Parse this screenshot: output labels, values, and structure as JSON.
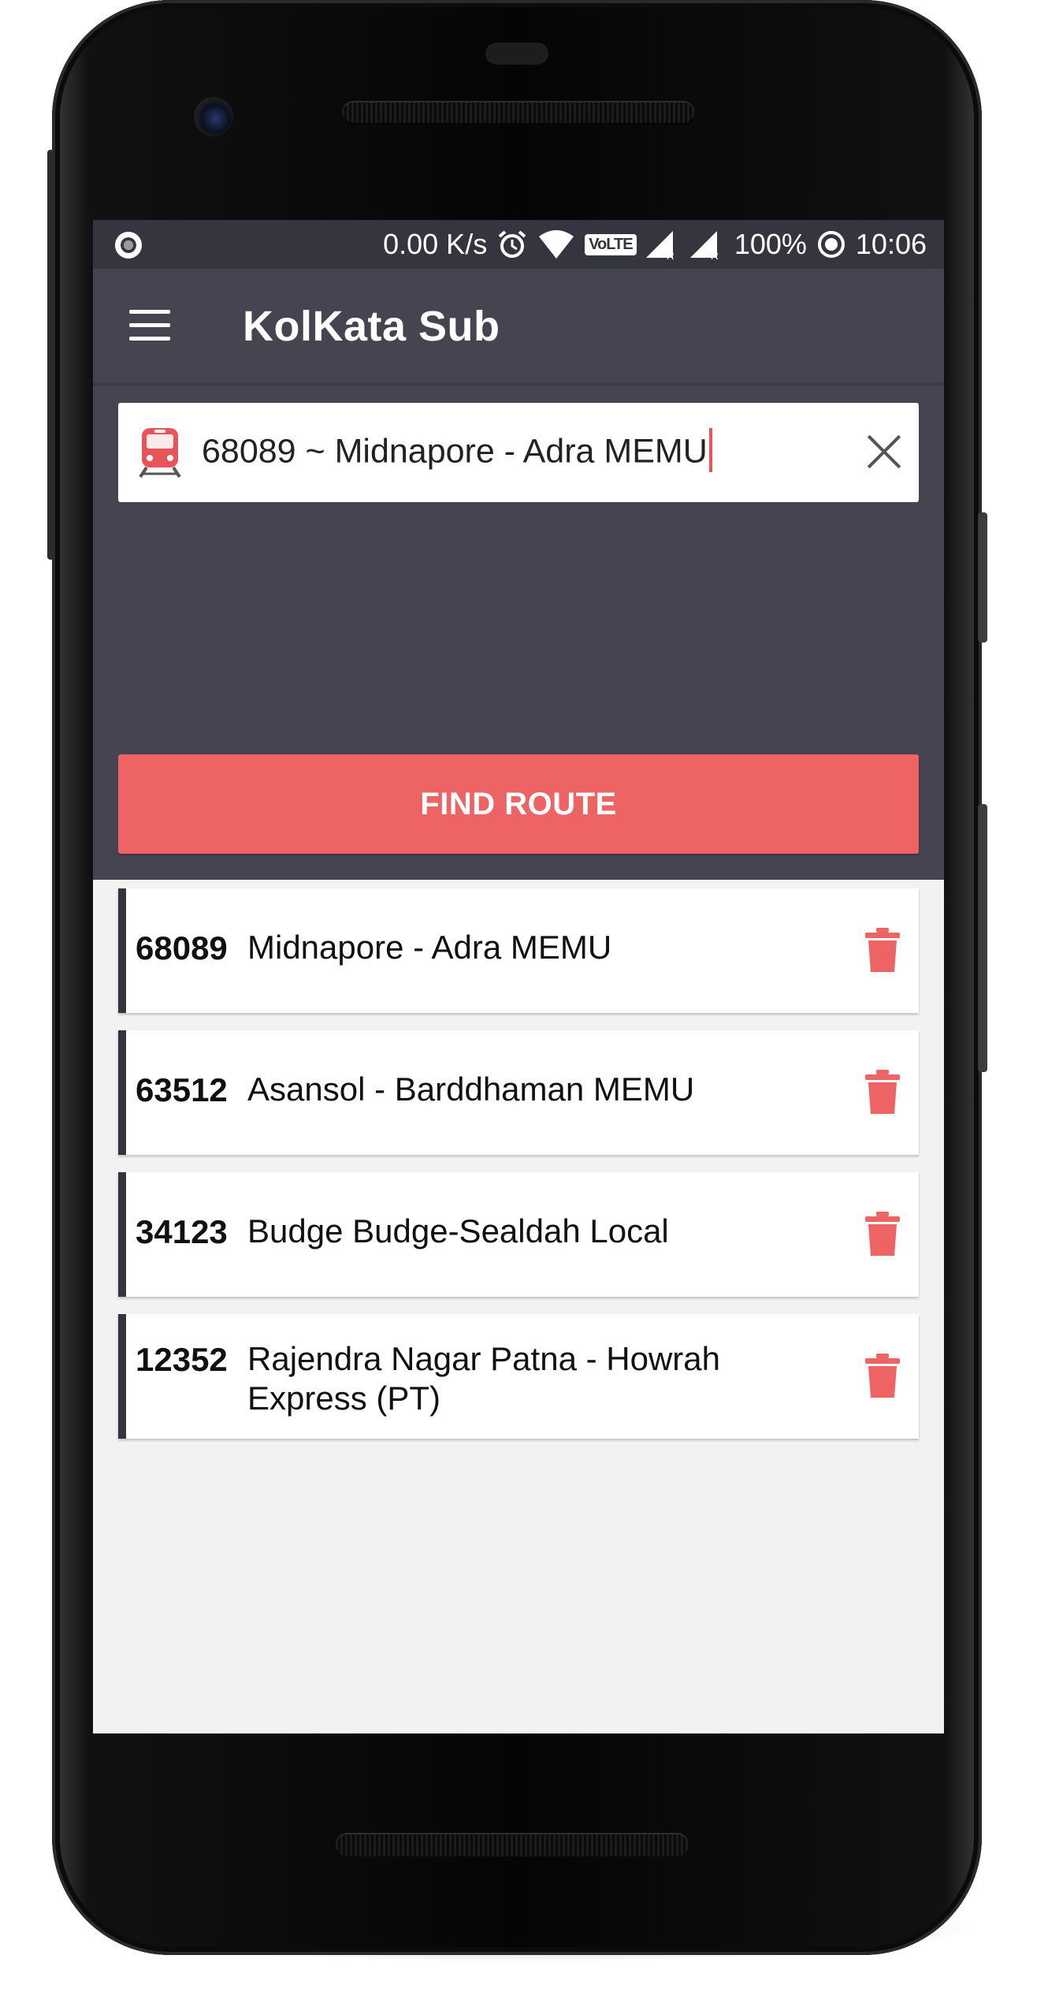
{
  "status_bar": {
    "speed": "0.00 K/s",
    "volte": "VoLTE",
    "sim1": "R",
    "sim2": "R",
    "battery": "100%",
    "time": "10:06"
  },
  "app_bar": {
    "title": "KolKata Sub",
    "menu_icon": "hamburger-menu-icon"
  },
  "search": {
    "icon": "train-icon",
    "value": "68089 ~ Midnapore - Adra MEMU",
    "clear_icon": "close-icon"
  },
  "find_button": {
    "label": "FIND ROUTE"
  },
  "recent_trains": [
    {
      "number": "68089",
      "name": "Midnapore - Adra MEMU"
    },
    {
      "number": "63512",
      "name": "Asansol - Barddhaman MEMU"
    },
    {
      "number": "34123",
      "name": "Budge Budge-Sealdah Local"
    },
    {
      "number": "12352",
      "name": "Rajendra Nagar Patna - Howrah Express (PT)"
    }
  ],
  "colors": {
    "primary_dark": "#464451",
    "status_bar": "#35353f",
    "accent": "#ee6363",
    "background": "#f2f2f2"
  }
}
